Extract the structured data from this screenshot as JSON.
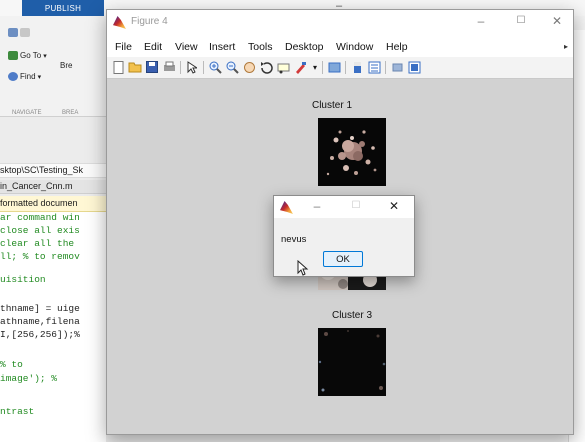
{
  "background": {
    "ribbon_tab": "PUBLISH",
    "ribbon_items": [
      {
        "label": "Go To",
        "icon": "goto-arrow-icon"
      },
      {
        "label": "Find",
        "icon": "magnifier-icon"
      },
      {
        "label": "Bre",
        "icon": "breakpoint-icon"
      }
    ],
    "ribbon_sections": [
      "NAVIGATE",
      "BREA"
    ],
    "path": "sktop\\SC\\Testing_Sk",
    "file_tab": "in_Cancer_Cnn.m",
    "notice": "formatted documen",
    "code_lines": [
      {
        "text": "ar command win",
        "style": "green"
      },
      {
        "text": "close all exis",
        "style": "green"
      },
      {
        "text": " clear all the",
        "style": "green"
      },
      {
        "text": "ll; % to remov",
        "style": "green"
      },
      {
        "text": "",
        "style": "dark"
      },
      {
        "text": "uisition",
        "style": "green"
      },
      {
        "text": "",
        "style": "dark"
      },
      {
        "text": "thname] = uige",
        "style": "dark"
      },
      {
        "text": "athname,filena",
        "style": "dark"
      },
      {
        "text": "I,[256,256]);%",
        "style": "dark"
      },
      {
        "text": "",
        "style": "dark"
      },
      {
        "text": "         % to",
        "style": "green"
      },
      {
        "text": "image');    % ",
        "style": "green"
      },
      {
        "text": "",
        "style": "dark"
      },
      {
        "text": "ntrast",
        "style": "green"
      }
    ]
  },
  "figure": {
    "title": "Figure 4",
    "menu": [
      "File",
      "Edit",
      "View",
      "Insert",
      "Tools",
      "Desktop",
      "Window",
      "Help"
    ],
    "toolbar_icons": [
      "new-figure-icon",
      "open-file-icon",
      "save-icon",
      "print-icon",
      "pointer-icon",
      "zoom-in-icon",
      "zoom-out-icon",
      "pan-icon",
      "rotate-icon",
      "data-cursor-icon",
      "brush-icon",
      "link-icon",
      "colorbar-icon",
      "legend-icon",
      "hide-tools-icon",
      "show-tools-icon"
    ],
    "clusters": [
      {
        "title": "Cluster 1"
      },
      {
        "title": "Cluster 3"
      }
    ]
  },
  "dialog": {
    "message": "nevus",
    "ok_label": "OK"
  },
  "colors": {
    "figure_bg": "#d2d2d2",
    "publish_tab": "#1f5ea9",
    "ok_border": "#0078d7",
    "comment_green": "#228b22"
  }
}
